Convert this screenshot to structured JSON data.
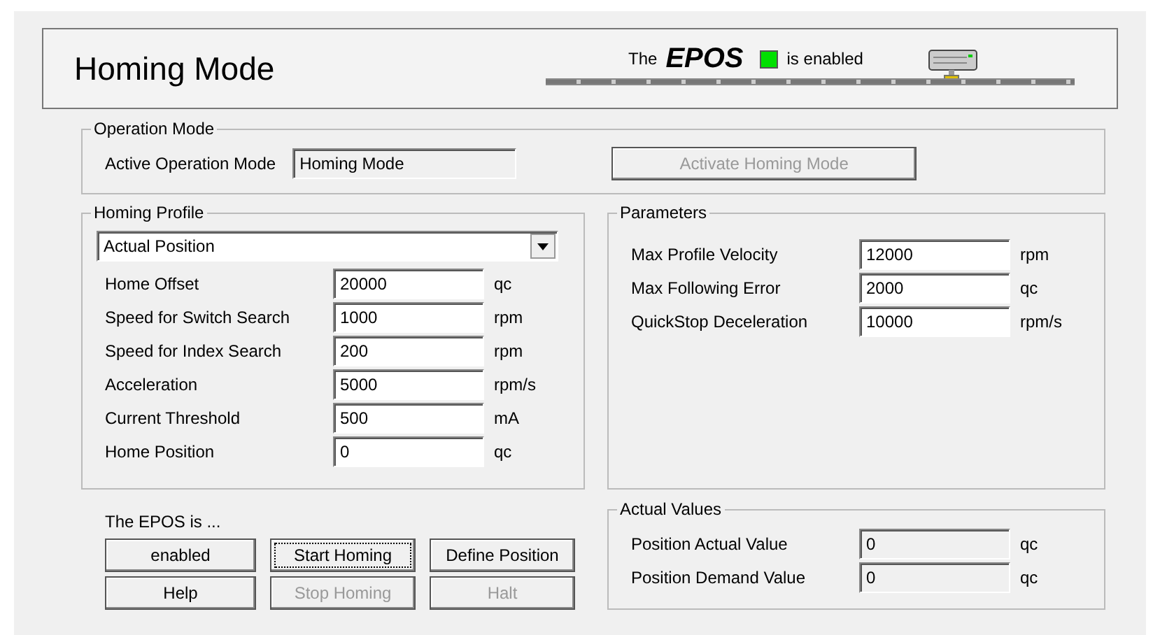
{
  "header": {
    "title": "Homing Mode",
    "status_prefix": "The",
    "device": "EPOS",
    "status_text": "is enabled",
    "enabled": true
  },
  "operation_mode": {
    "title": "Operation Mode",
    "label": "Active Operation Mode",
    "value": "Homing Mode",
    "button": {
      "label": "Activate Homing Mode",
      "disabled": true
    }
  },
  "homing_profile": {
    "title": "Homing Profile",
    "method": "Actual Position",
    "fields": [
      {
        "label": "Home Offset",
        "value": "20000",
        "unit": "qc",
        "readonly": false
      },
      {
        "label": "Speed for Switch Search",
        "value": "1000",
        "unit": "rpm",
        "readonly": false
      },
      {
        "label": "Speed for Index Search",
        "value": "200",
        "unit": "rpm",
        "readonly": false
      },
      {
        "label": "Acceleration",
        "value": "5000",
        "unit": "rpm/s",
        "readonly": false
      },
      {
        "label": "Current Threshold",
        "value": "500",
        "unit": "mA",
        "readonly": false
      },
      {
        "label": "Home Position",
        "value": "0",
        "unit": "qc",
        "readonly": false
      }
    ]
  },
  "parameters": {
    "title": "Parameters",
    "fields": [
      {
        "label": "Max Profile Velocity",
        "value": "12000",
        "unit": "rpm",
        "readonly": false
      },
      {
        "label": "Max Following Error",
        "value": "2000",
        "unit": "qc",
        "readonly": false
      },
      {
        "label": "QuickStop Deceleration",
        "value": "10000",
        "unit": "rpm/s",
        "readonly": false
      }
    ]
  },
  "status": {
    "label": "The EPOS is ...",
    "buttons": [
      {
        "label": "enabled",
        "disabled": false,
        "focused": false
      },
      {
        "label": "Start Homing",
        "disabled": false,
        "focused": true
      },
      {
        "label": "Define Position",
        "disabled": false,
        "focused": false
      },
      {
        "label": "Help",
        "disabled": false,
        "focused": false
      },
      {
        "label": "Stop Homing",
        "disabled": true,
        "focused": false
      },
      {
        "label": "Halt",
        "disabled": true,
        "focused": false
      }
    ]
  },
  "actual_values": {
    "title": "Actual Values",
    "fields": [
      {
        "label": "Position Actual Value",
        "value": "0",
        "unit": "qc",
        "readonly": true
      },
      {
        "label": "Position Demand Value",
        "value": "0",
        "unit": "qc",
        "readonly": true
      }
    ]
  }
}
